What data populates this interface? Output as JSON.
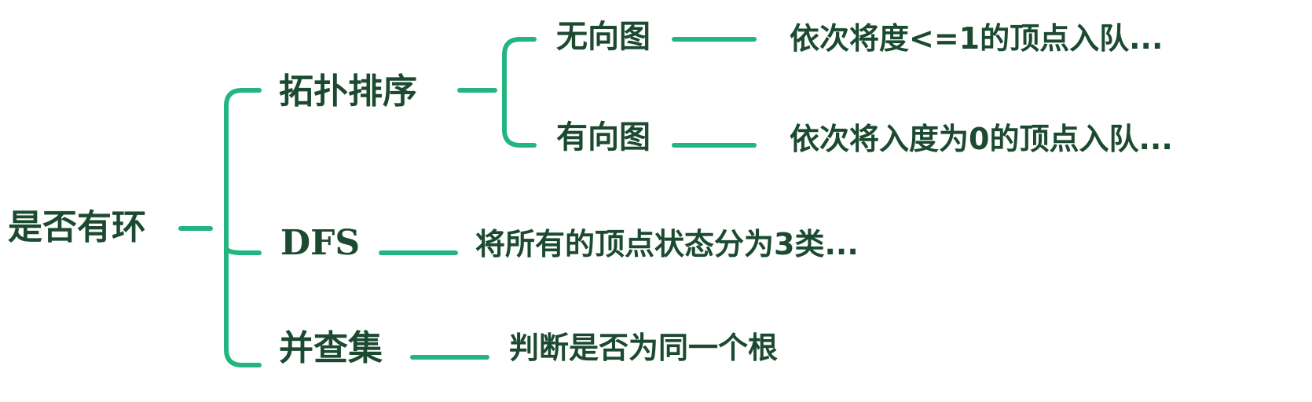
{
  "root": {
    "label": "是否有环"
  },
  "branches": {
    "topo": {
      "label": "拓扑排序",
      "undirected": {
        "label": "无向图",
        "detail": "依次将度<=1的顶点入队..."
      },
      "directed": {
        "label": "有向图",
        "detail": "依次将入度为0的顶点入队..."
      }
    },
    "dfs": {
      "label": "DFS",
      "detail": "将所有的顶点状态分为3类..."
    },
    "union_find": {
      "label": "并查集",
      "detail": "判断是否为同一个根"
    }
  },
  "colors": {
    "connector": "#23b57f",
    "text": "#1b4a30",
    "background": "#ffffff"
  }
}
